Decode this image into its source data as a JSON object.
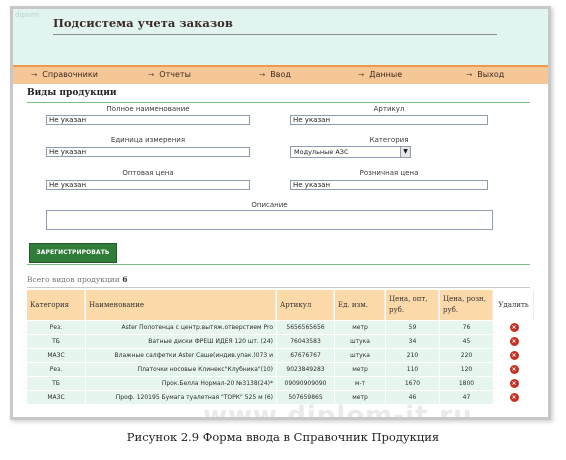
{
  "app": {
    "title": "Подсистема учета заказов",
    "corner_mark": "diplom"
  },
  "nav": [
    {
      "label": "Справочники"
    },
    {
      "label": "Отчеты"
    },
    {
      "label": "Ввод"
    },
    {
      "label": "Данные"
    },
    {
      "label": "Выход"
    }
  ],
  "section_title": "Виды продукции",
  "form": {
    "full_name": {
      "label": "Полное наименование",
      "value": "Не указан"
    },
    "article": {
      "label": "Артикул",
      "value": "Не указан"
    },
    "unit": {
      "label": "Единица измерения",
      "value": "Не указан"
    },
    "category": {
      "label": "Категория",
      "value": "Модульные АЗС"
    },
    "wholesale_price": {
      "label": "Оптовая цена",
      "value": "Не указан"
    },
    "retail_price": {
      "label": "Розничная цена",
      "value": "Не указан"
    },
    "description": {
      "label": "Описание",
      "value": ""
    },
    "register_button": "ЗАРЕГИСТРИРОВАТЬ"
  },
  "summary": {
    "label": "Всего видов продукции",
    "count": "6"
  },
  "table": {
    "headers": {
      "category": "Категория",
      "name": "Наименование",
      "article": "Артикул",
      "unit": "Ед. изм.",
      "price_wholesale": "Цена, опт, руб.",
      "price_retail": "Цена, розн, руб.",
      "delete": "Удалить"
    },
    "rows": [
      {
        "category": "Рез.",
        "name": "Aster Полотенца с центр.вытяж.отверстием Pro",
        "article": "5656565656",
        "unit": "метр",
        "wholesale": "59",
        "retail": "76"
      },
      {
        "category": "ТБ",
        "name": "Ватные диски ФРЕШ ИДЕЯ 120 шт. (24)",
        "article": "76043583",
        "unit": "штука",
        "wholesale": "34",
        "retail": "45"
      },
      {
        "category": "МАЗС",
        "name": "Влажные салфетки Aster Саше(индив.упак.)073 и",
        "article": "67676767",
        "unit": "штука",
        "wholesale": "210",
        "retail": "220"
      },
      {
        "category": "Рез.",
        "name": "Платочки носовые Клинекс\"Клубника\"(10)",
        "article": "9023849283",
        "unit": "метр",
        "wholesale": "110",
        "retail": "120"
      },
      {
        "category": "ТБ",
        "name": "Прок.Белла Нормал-20 №3138(24)*",
        "article": "09090909090",
        "unit": "м-т",
        "wholesale": "1670",
        "retail": "1800"
      },
      {
        "category": "МАЗС",
        "name": "Проф. 120195 Бумага туалетная \"ТОРК\" 525 м (6)",
        "article": "507659865",
        "metr": "",
        "unit": "метр",
        "wholesale": "46",
        "retail": "47"
      }
    ]
  },
  "watermark": "www.diplom-it.ru",
  "caption": "Рисунок 2.9 Форма ввода в Справочник Продукция",
  "colors": {
    "header_bg": "#e2f4ef",
    "nav_bg": "#f6c796",
    "nav_border": "#ee9a4a",
    "table_header_bg": "#fbd9a9",
    "table_row_bg": "#e6f6ef",
    "button_bg": "#2f7d38",
    "delete_icon": "#c43122",
    "rule_green": "#7cc087"
  }
}
